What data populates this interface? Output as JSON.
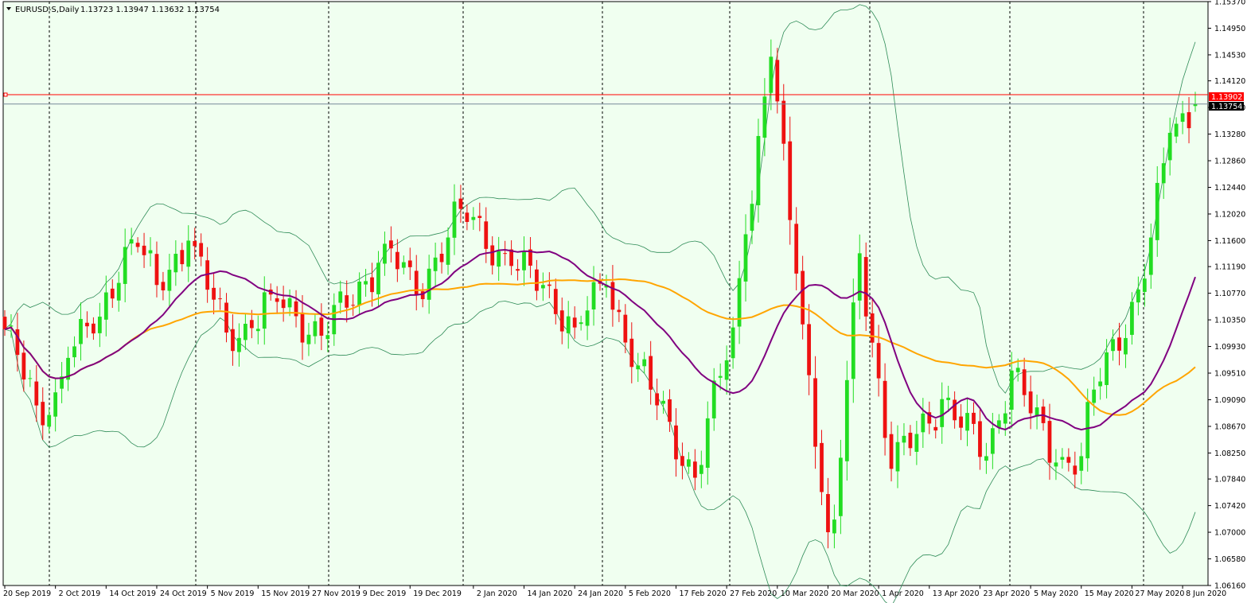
{
  "header": {
    "symbol_timeframe": "EURUSD-S,Daily",
    "ohlc": "1.13723 1.13947 1.13632 1.13754"
  },
  "price_tags": {
    "ask": "1.13902",
    "bid": "1.13754"
  },
  "colors": {
    "background": "#ffffff",
    "chart_area": "#f0fff0",
    "bull_candle": "#22dd22",
    "bear_candle": "#ee1111",
    "bollinger": "#2e8b57",
    "ma_fast": "#800080",
    "ma_slow": "#ffa500",
    "ask_line": "#ff0000",
    "bid_line": "#778899"
  },
  "chart_data": {
    "type": "candlestick",
    "title": "EURUSD-S,Daily",
    "ylim": [
      1.0616,
      1.1537
    ],
    "y_ticks": [
      "1.15370",
      "1.14950",
      "1.14530",
      "1.14120",
      "1.13700",
      "1.13280",
      "1.12860",
      "1.12440",
      "1.12020",
      "1.11600",
      "1.11190",
      "1.10770",
      "1.10350",
      "1.09930",
      "1.09510",
      "1.09090",
      "1.08670",
      "1.08250",
      "1.07840",
      "1.07420",
      "1.07000",
      "1.06580",
      "1.06160"
    ],
    "x_labels": [
      "20 Sep 2019",
      "2 Oct 2019",
      "14 Oct 2019",
      "24 Oct 2019",
      "5 Nov 2019",
      "15 Nov 2019",
      "27 Nov 2019",
      "9 Dec 2019",
      "19 Dec 2019",
      "2 Jan 2020",
      "14 Jan 2020",
      "24 Jan 2020",
      "5 Feb 2020",
      "17 Feb 2020",
      "27 Feb 2020",
      "10 Mar 2020",
      "20 Mar 2020",
      "1 Apr 2020",
      "13 Apr 2020",
      "23 Apr 2020",
      "5 May 2020",
      "15 May 2020",
      "27 May 2020",
      "8 Jun 2020"
    ],
    "ohlc_anchors": [
      {
        "date": "20 Sep 2019",
        "close": 1.102
      },
      {
        "date": "27 Sep 2019",
        "close": 1.09
      },
      {
        "date": "1 Oct 2019",
        "close": 1.0885
      },
      {
        "date": "4 Oct 2019",
        "close": 1.0975
      },
      {
        "date": "11 Oct 2019",
        "close": 1.104
      },
      {
        "date": "17 Oct 2019",
        "close": 1.115
      },
      {
        "date": "21 Oct 2019",
        "close": 1.115
      },
      {
        "date": "24 Oct 2019",
        "close": 1.109
      },
      {
        "date": "31 Oct 2019",
        "close": 1.116
      },
      {
        "date": "8 Nov 2019",
        "close": 1.1015
      },
      {
        "date": "14 Nov 2019",
        "close": 1.1022
      },
      {
        "date": "19 Nov 2019",
        "close": 1.1075
      },
      {
        "date": "29 Nov 2019",
        "close": 1.101
      },
      {
        "date": "12 Dec 2019",
        "close": 1.1125
      },
      {
        "date": "13 Dec 2019",
        "close": 1.1155
      },
      {
        "date": "20 Dec 2019",
        "close": 1.1075
      },
      {
        "date": "31 Dec 2019",
        "close": 1.121
      },
      {
        "date": "10 Jan 2020",
        "close": 1.112
      },
      {
        "date": "17 Jan 2020",
        "close": 1.109
      },
      {
        "date": "24 Jan 2020",
        "close": 1.1023
      },
      {
        "date": "31 Jan 2020",
        "close": 1.109
      },
      {
        "date": "7 Feb 2020",
        "close": 1.0963
      },
      {
        "date": "20 Feb 2020",
        "close": 1.0786
      },
      {
        "date": "28 Feb 2020",
        "close": 1.1023
      },
      {
        "date": "3 Mar 2020",
        "close": 1.117
      },
      {
        "date": "9 Mar 2020",
        "close": 1.145
      },
      {
        "date": "13 Mar 2020",
        "close": 1.1108
      },
      {
        "date": "20 Mar 2020",
        "close": 1.07
      },
      {
        "date": "23 Mar 2020",
        "close": 1.072
      },
      {
        "date": "27 Mar 2020",
        "close": 1.114
      },
      {
        "date": "3 Apr 2020",
        "close": 1.08
      },
      {
        "date": "15 Apr 2020",
        "close": 1.091
      },
      {
        "date": "24 Apr 2020",
        "close": 1.082
      },
      {
        "date": "30 Apr 2020",
        "close": 1.0955
      },
      {
        "date": "11 May 2020",
        "close": 1.081
      },
      {
        "date": "15 May 2020",
        "close": 1.082
      },
      {
        "date": "19 May 2020",
        "close": 1.0925
      },
      {
        "date": "29 May 2020",
        "close": 1.11
      },
      {
        "date": "4 Jun 2020",
        "close": 1.133
      },
      {
        "date": "10 Jun 2020",
        "close": 1.1375
      }
    ],
    "last_candle": {
      "open": 1.13723,
      "high": 1.13947,
      "low": 1.13632,
      "close": 1.13754
    },
    "current_price": 1.13754,
    "ask_price": 1.13902,
    "indicators": [
      "Bollinger Bands",
      "Moving Average (fast)",
      "Moving Average (slow)"
    ],
    "grid": "vertical dashed period separators"
  }
}
